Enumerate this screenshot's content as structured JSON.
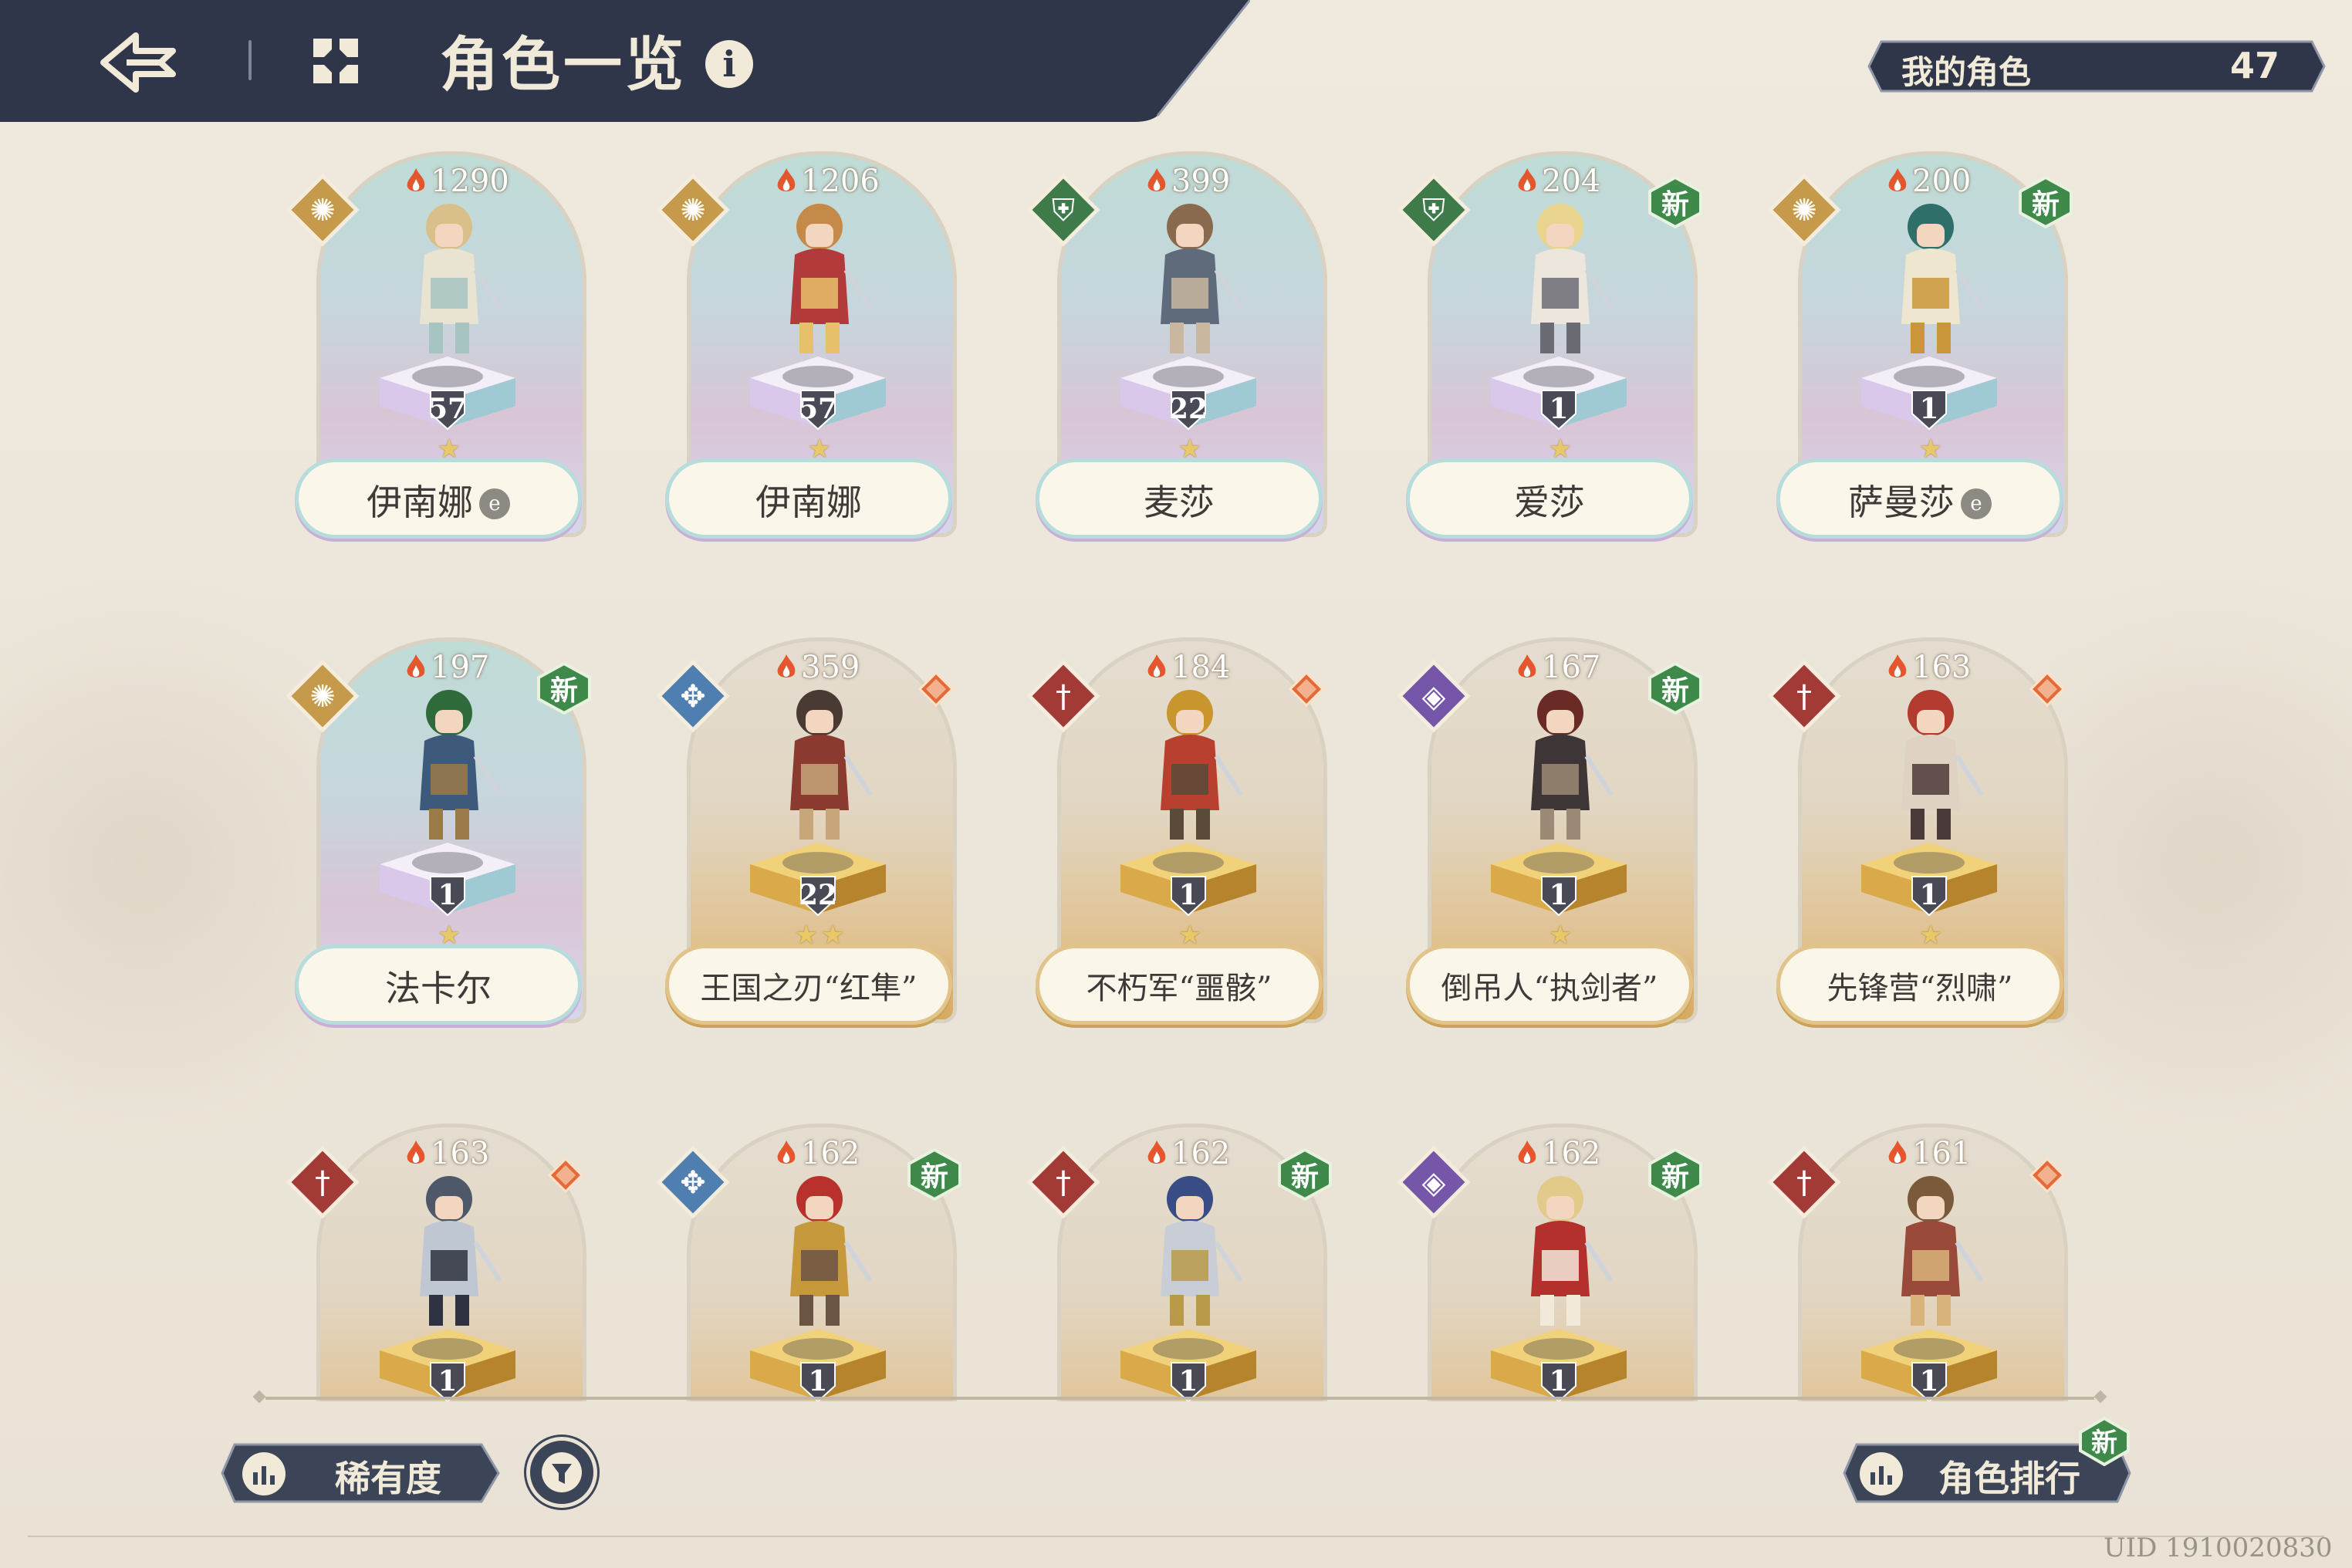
{
  "header": {
    "title": "角色一览",
    "info_symbol": "i",
    "my_characters_label": "我的角色",
    "my_characters_count": "47"
  },
  "icons": {
    "back": "back-arrow-icon",
    "grid": "grid-menu-icon",
    "info": "info-icon",
    "flame": "flame-icon",
    "new": "new-badge-icon",
    "rarity": "bar-chart-icon",
    "filter": "filter-icon",
    "ranking": "bar-chart-icon"
  },
  "colors": {
    "header_bg": "#2f3649",
    "new_badge": "#3f8a4a",
    "rare_badge": "#e46a3a",
    "element_gold": "#c59a4a",
    "element_green": "#3e7a4a",
    "element_blue": "#4f7fb0",
    "element_red": "#a23a36",
    "element_purple": "#7656a8"
  },
  "characters": [
    {
      "name": "伊南娜",
      "power": "1290",
      "level": "57",
      "stars": "★",
      "element": "gold",
      "style": "blue",
      "new": false,
      "rare": false,
      "mark": true
    },
    {
      "name": "伊南娜",
      "power": "1206",
      "level": "57",
      "stars": "★",
      "element": "gold",
      "style": "blue",
      "new": false,
      "rare": false,
      "mark": false
    },
    {
      "name": "麦莎",
      "power": "399",
      "level": "22",
      "stars": "★",
      "element": "green",
      "style": "blue",
      "new": false,
      "rare": false,
      "mark": false
    },
    {
      "name": "爱莎",
      "power": "204",
      "level": "1",
      "stars": "★",
      "element": "green",
      "style": "blue",
      "new": true,
      "rare": false,
      "mark": false
    },
    {
      "name": "萨曼莎",
      "power": "200",
      "level": "1",
      "stars": "★",
      "element": "gold",
      "style": "blue",
      "new": true,
      "rare": false,
      "mark": true
    },
    {
      "name": "法卡尔",
      "power": "197",
      "level": "1",
      "stars": "★",
      "element": "gold",
      "style": "blue",
      "new": true,
      "rare": false,
      "mark": false
    },
    {
      "name": "王国之刃“红隼”",
      "power": "359",
      "level": "22",
      "stars": "★★",
      "element": "blue",
      "style": "gold",
      "new": false,
      "rare": true,
      "mark": false
    },
    {
      "name": "不朽军“噩骸”",
      "power": "184",
      "level": "1",
      "stars": "★",
      "element": "red",
      "style": "gold",
      "new": false,
      "rare": true,
      "mark": false
    },
    {
      "name": "倒吊人“执剑者”",
      "power": "167",
      "level": "1",
      "stars": "★",
      "element": "purple",
      "style": "gold",
      "new": true,
      "rare": false,
      "mark": false
    },
    {
      "name": "先锋营“烈啸”",
      "power": "163",
      "level": "1",
      "stars": "★",
      "element": "red",
      "style": "gold",
      "new": false,
      "rare": true,
      "mark": false
    },
    {
      "name": "",
      "power": "163",
      "level": "1",
      "stars": "",
      "element": "red",
      "style": "gold",
      "new": false,
      "rare": true,
      "mark": false
    },
    {
      "name": "",
      "power": "162",
      "level": "1",
      "stars": "",
      "element": "blue",
      "style": "gold",
      "new": true,
      "rare": false,
      "mark": false
    },
    {
      "name": "",
      "power": "162",
      "level": "1",
      "stars": "",
      "element": "red",
      "style": "gold",
      "new": true,
      "rare": false,
      "mark": false
    },
    {
      "name": "",
      "power": "162",
      "level": "1",
      "stars": "",
      "element": "purple",
      "style": "gold",
      "new": true,
      "rare": false,
      "mark": false
    },
    {
      "name": "",
      "power": "161",
      "level": "1",
      "stars": "",
      "element": "red",
      "style": "gold",
      "new": false,
      "rare": true,
      "mark": false
    }
  ],
  "badges": {
    "new_label": "新",
    "mark_label": "e"
  },
  "toolbar": {
    "sort_label": "稀有度",
    "ranking_label": "角色排行",
    "ranking_new": "新"
  },
  "footer": {
    "uid": "UID 1910020830"
  }
}
